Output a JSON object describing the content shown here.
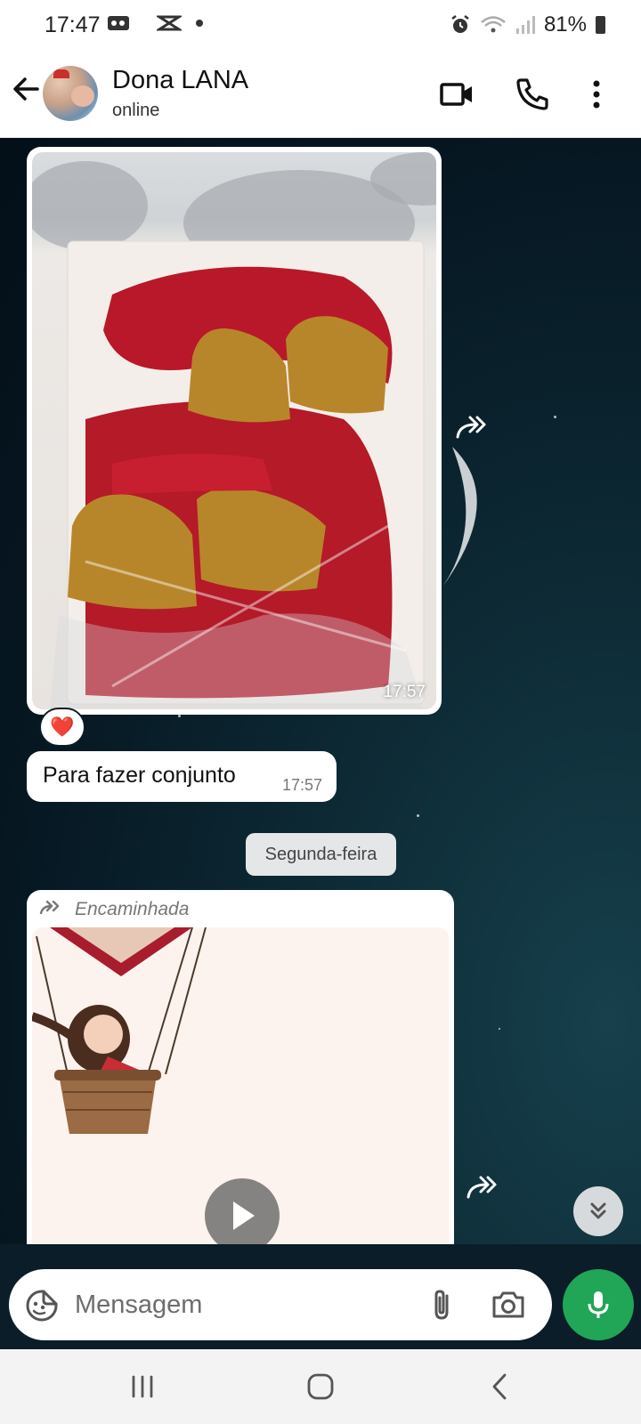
{
  "status_bar": {
    "time": "17:47",
    "battery": "81%",
    "icons": [
      "voicemail-icon",
      "capcut-icon",
      "dot-icon",
      "alarm-icon",
      "wifi-icon",
      "signal-icon",
      "battery-icon"
    ]
  },
  "header": {
    "contact_name": "Dona LANA",
    "contact_status": "online",
    "icons": [
      "back-arrow-icon",
      "avatar",
      "video-call-icon",
      "phone-icon",
      "more-options-icon"
    ]
  },
  "messages": [
    {
      "type": "image",
      "time": "17:57",
      "reaction": "❤️",
      "description_icon": "crochet-bells-photo"
    },
    {
      "type": "text",
      "text": "Para fazer conjunto",
      "time": "17:57"
    }
  ],
  "date_separator": "Segunda-feira",
  "forwarded": {
    "label": "Encaminhada",
    "media": "video"
  },
  "compose": {
    "placeholder": "Mensagem"
  },
  "colors": {
    "accent_green": "#21a557",
    "chat_bg": "#061722",
    "bubble": "#ffffff"
  }
}
